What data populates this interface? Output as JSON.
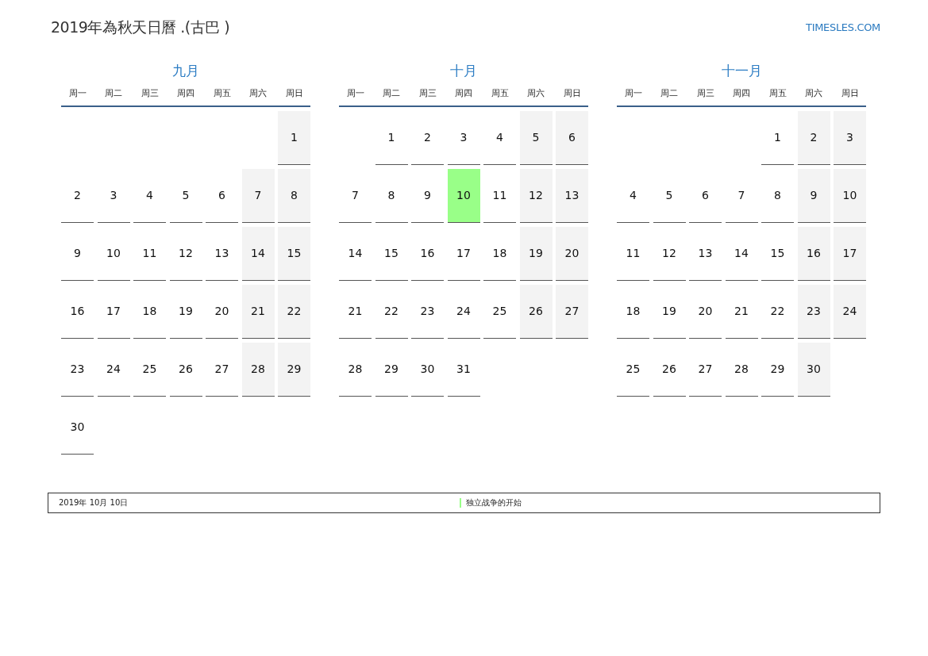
{
  "title": "2019年為秋天日曆 .(古巴 )",
  "logo": "TIMESLES.COM",
  "months": [
    {
      "name": "九月",
      "weekdays": [
        "周一",
        "周二",
        "周三",
        "周四",
        "周五",
        "周六",
        "周日"
      ],
      "weeks": [
        [
          {
            "kind": "blank"
          },
          {
            "kind": "blank"
          },
          {
            "kind": "blank"
          },
          {
            "kind": "blank"
          },
          {
            "kind": "blank"
          },
          {
            "kind": "blank"
          },
          {
            "kind": "day",
            "day": "1",
            "weekend": true
          }
        ],
        [
          {
            "kind": "day",
            "day": "2",
            "weekend": false
          },
          {
            "kind": "day",
            "day": "3",
            "weekend": false
          },
          {
            "kind": "day",
            "day": "4",
            "weekend": false
          },
          {
            "kind": "day",
            "day": "5",
            "weekend": false
          },
          {
            "kind": "day",
            "day": "6",
            "weekend": false
          },
          {
            "kind": "day",
            "day": "7",
            "weekend": true
          },
          {
            "kind": "day",
            "day": "8",
            "weekend": true
          }
        ],
        [
          {
            "kind": "day",
            "day": "9",
            "weekend": false
          },
          {
            "kind": "day",
            "day": "10",
            "weekend": false
          },
          {
            "kind": "day",
            "day": "11",
            "weekend": false
          },
          {
            "kind": "day",
            "day": "12",
            "weekend": false
          },
          {
            "kind": "day",
            "day": "13",
            "weekend": false
          },
          {
            "kind": "day",
            "day": "14",
            "weekend": true
          },
          {
            "kind": "day",
            "day": "15",
            "weekend": true
          }
        ],
        [
          {
            "kind": "day",
            "day": "16",
            "weekend": false
          },
          {
            "kind": "day",
            "day": "17",
            "weekend": false
          },
          {
            "kind": "day",
            "day": "18",
            "weekend": false
          },
          {
            "kind": "day",
            "day": "19",
            "weekend": false
          },
          {
            "kind": "day",
            "day": "20",
            "weekend": false
          },
          {
            "kind": "day",
            "day": "21",
            "weekend": true
          },
          {
            "kind": "day",
            "day": "22",
            "weekend": true
          }
        ],
        [
          {
            "kind": "day",
            "day": "23",
            "weekend": false
          },
          {
            "kind": "day",
            "day": "24",
            "weekend": false
          },
          {
            "kind": "day",
            "day": "25",
            "weekend": false
          },
          {
            "kind": "day",
            "day": "26",
            "weekend": false
          },
          {
            "kind": "day",
            "day": "27",
            "weekend": false
          },
          {
            "kind": "day",
            "day": "28",
            "weekend": true
          },
          {
            "kind": "day",
            "day": "29",
            "weekend": true
          }
        ],
        [
          {
            "kind": "day",
            "day": "30",
            "weekend": false
          },
          {
            "kind": "blank"
          },
          {
            "kind": "blank"
          },
          {
            "kind": "blank"
          },
          {
            "kind": "blank"
          },
          {
            "kind": "blank"
          },
          {
            "kind": "blank"
          }
        ]
      ]
    },
    {
      "name": "十月",
      "weekdays": [
        "周一",
        "周二",
        "周三",
        "周四",
        "周五",
        "周六",
        "周日"
      ],
      "weeks": [
        [
          {
            "kind": "blank"
          },
          {
            "kind": "day",
            "day": "1",
            "weekend": false
          },
          {
            "kind": "day",
            "day": "2",
            "weekend": false
          },
          {
            "kind": "day",
            "day": "3",
            "weekend": false
          },
          {
            "kind": "day",
            "day": "4",
            "weekend": false
          },
          {
            "kind": "day",
            "day": "5",
            "weekend": true
          },
          {
            "kind": "day",
            "day": "6",
            "weekend": true
          }
        ],
        [
          {
            "kind": "day",
            "day": "7",
            "weekend": false
          },
          {
            "kind": "day",
            "day": "8",
            "weekend": false
          },
          {
            "kind": "day",
            "day": "9",
            "weekend": false
          },
          {
            "kind": "day",
            "day": "10",
            "color": "#99ff88"
          },
          {
            "kind": "day",
            "day": "11",
            "weekend": false
          },
          {
            "kind": "day",
            "day": "12",
            "weekend": true
          },
          {
            "kind": "day",
            "day": "13",
            "weekend": true
          }
        ],
        [
          {
            "kind": "day",
            "day": "14",
            "weekend": false
          },
          {
            "kind": "day",
            "day": "15",
            "weekend": false
          },
          {
            "kind": "day",
            "day": "16",
            "weekend": false
          },
          {
            "kind": "day",
            "day": "17",
            "weekend": false
          },
          {
            "kind": "day",
            "day": "18",
            "weekend": false
          },
          {
            "kind": "day",
            "day": "19",
            "weekend": true
          },
          {
            "kind": "day",
            "day": "20",
            "weekend": true
          }
        ],
        [
          {
            "kind": "day",
            "day": "21",
            "weekend": false
          },
          {
            "kind": "day",
            "day": "22",
            "weekend": false
          },
          {
            "kind": "day",
            "day": "23",
            "weekend": false
          },
          {
            "kind": "day",
            "day": "24",
            "weekend": false
          },
          {
            "kind": "day",
            "day": "25",
            "weekend": false
          },
          {
            "kind": "day",
            "day": "26",
            "weekend": true
          },
          {
            "kind": "day",
            "day": "27",
            "weekend": true
          }
        ],
        [
          {
            "kind": "day",
            "day": "28",
            "weekend": false
          },
          {
            "kind": "day",
            "day": "29",
            "weekend": false
          },
          {
            "kind": "day",
            "day": "30",
            "weekend": false
          },
          {
            "kind": "day",
            "day": "31",
            "weekend": false
          },
          {
            "kind": "blank"
          },
          {
            "kind": "blank"
          },
          {
            "kind": "blank"
          }
        ]
      ]
    },
    {
      "name": "十一月",
      "weekdays": [
        "周一",
        "周二",
        "周三",
        "周四",
        "周五",
        "周六",
        "周日"
      ],
      "weeks": [
        [
          {
            "kind": "blank"
          },
          {
            "kind": "blank"
          },
          {
            "kind": "blank"
          },
          {
            "kind": "blank"
          },
          {
            "kind": "day",
            "day": "1",
            "weekend": false
          },
          {
            "kind": "day",
            "day": "2",
            "weekend": true
          },
          {
            "kind": "day",
            "day": "3",
            "weekend": true
          }
        ],
        [
          {
            "kind": "day",
            "day": "4",
            "weekend": false
          },
          {
            "kind": "day",
            "day": "5",
            "weekend": false
          },
          {
            "kind": "day",
            "day": "6",
            "weekend": false
          },
          {
            "kind": "day",
            "day": "7",
            "weekend": false
          },
          {
            "kind": "day",
            "day": "8",
            "weekend": false
          },
          {
            "kind": "day",
            "day": "9",
            "weekend": true
          },
          {
            "kind": "day",
            "day": "10",
            "weekend": true
          }
        ],
        [
          {
            "kind": "day",
            "day": "11",
            "weekend": false
          },
          {
            "kind": "day",
            "day": "12",
            "weekend": false
          },
          {
            "kind": "day",
            "day": "13",
            "weekend": false
          },
          {
            "kind": "day",
            "day": "14",
            "weekend": false
          },
          {
            "kind": "day",
            "day": "15",
            "weekend": false
          },
          {
            "kind": "day",
            "day": "16",
            "weekend": true
          },
          {
            "kind": "day",
            "day": "17",
            "weekend": true
          }
        ],
        [
          {
            "kind": "day",
            "day": "18",
            "weekend": false
          },
          {
            "kind": "day",
            "day": "19",
            "weekend": false
          },
          {
            "kind": "day",
            "day": "20",
            "weekend": false
          },
          {
            "kind": "day",
            "day": "21",
            "weekend": false
          },
          {
            "kind": "day",
            "day": "22",
            "weekend": false
          },
          {
            "kind": "day",
            "day": "23",
            "weekend": true
          },
          {
            "kind": "day",
            "day": "24",
            "weekend": true
          }
        ],
        [
          {
            "kind": "day",
            "day": "25",
            "weekend": false
          },
          {
            "kind": "day",
            "day": "26",
            "weekend": false
          },
          {
            "kind": "day",
            "day": "27",
            "weekend": false
          },
          {
            "kind": "day",
            "day": "28",
            "weekend": false
          },
          {
            "kind": "day",
            "day": "29",
            "weekend": false
          },
          {
            "kind": "day",
            "day": "30",
            "weekend": true
          },
          {
            "kind": "blank"
          }
        ]
      ]
    }
  ],
  "holidays": [
    {
      "date": "2019年 10月 10日",
      "name": "独立战争的开始",
      "color": "#99ff88"
    }
  ]
}
